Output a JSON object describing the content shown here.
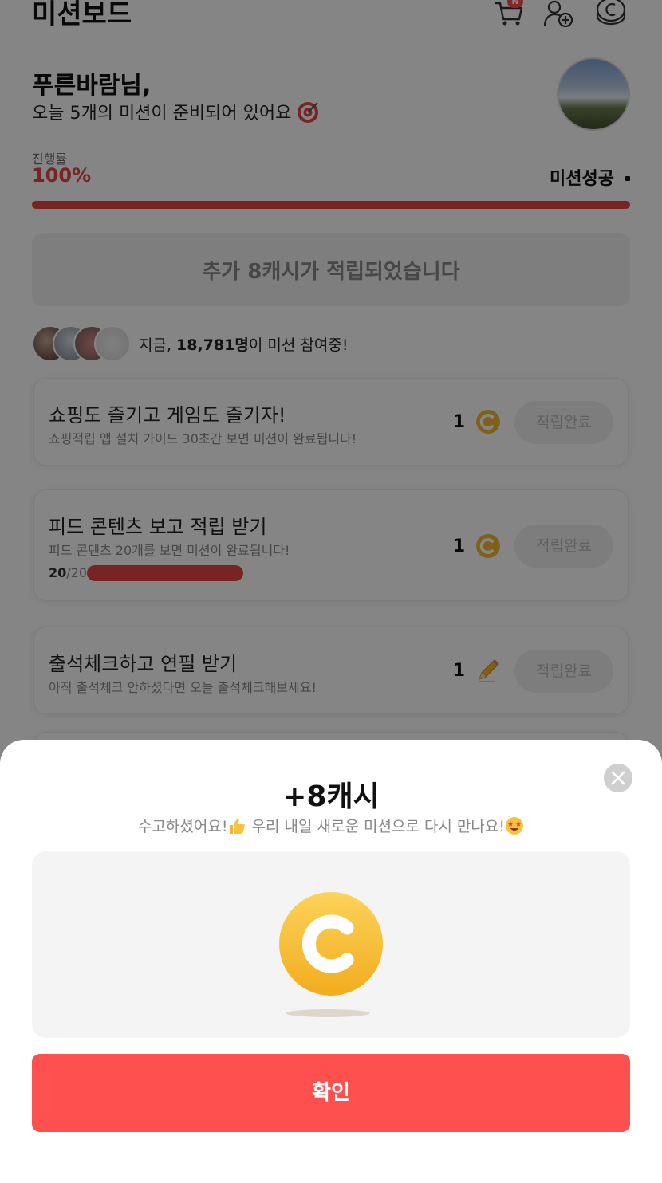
{
  "header": {
    "title": "미션보드",
    "cart_badge": "N",
    "icons": [
      "cart-icon",
      "add-friend-icon",
      "coin-icon"
    ]
  },
  "greeting": {
    "name": "푸른바람님,",
    "subtitle": "오늘 5개의 미션이 준비되어 있어요"
  },
  "progress": {
    "label": "진행률",
    "value": "100%",
    "fraction": 1.0,
    "status": "미션성공",
    "color": "#e84646"
  },
  "extra_reward": "추가 8캐시가 적립되었습니다",
  "participants": {
    "prefix": "지금, ",
    "count": "18,781명",
    "suffix": "이 미션 참여중!"
  },
  "missions": [
    {
      "title": "쇼핑도 즐기고 게임도 즐기자!",
      "desc": "쇼핑적립 앱 설치 가이드 30초간 보면 미션이 완료됩니다!",
      "reward": "1",
      "reward_icon": "coin-icon",
      "button": "적립완료"
    },
    {
      "title": "피드 콘텐츠 보고 적립 받기",
      "desc": "피드 콘텐츠 20개를 보면 미션이 완료됩니다!",
      "reward": "1",
      "reward_icon": "coin-icon",
      "button": "적립완료",
      "progress_current": "20",
      "progress_total": "/20",
      "progress_fraction": 1.0
    },
    {
      "title": "출석체크하고 연필 받기",
      "desc": "아직 출석체크 안하셨다면 오늘 출석체크해보세요!",
      "reward": "1",
      "reward_icon": "pencil-icon",
      "button": "적립완료"
    }
  ],
  "modal": {
    "title": "+8캐시",
    "subtitle_a": "수고하셨어요!",
    "subtitle_b": " 우리 내일 새로운 미션으로 다시 만나요!",
    "confirm": "확인",
    "accent": "#ff5050",
    "coin_color": "#f5b92c"
  }
}
